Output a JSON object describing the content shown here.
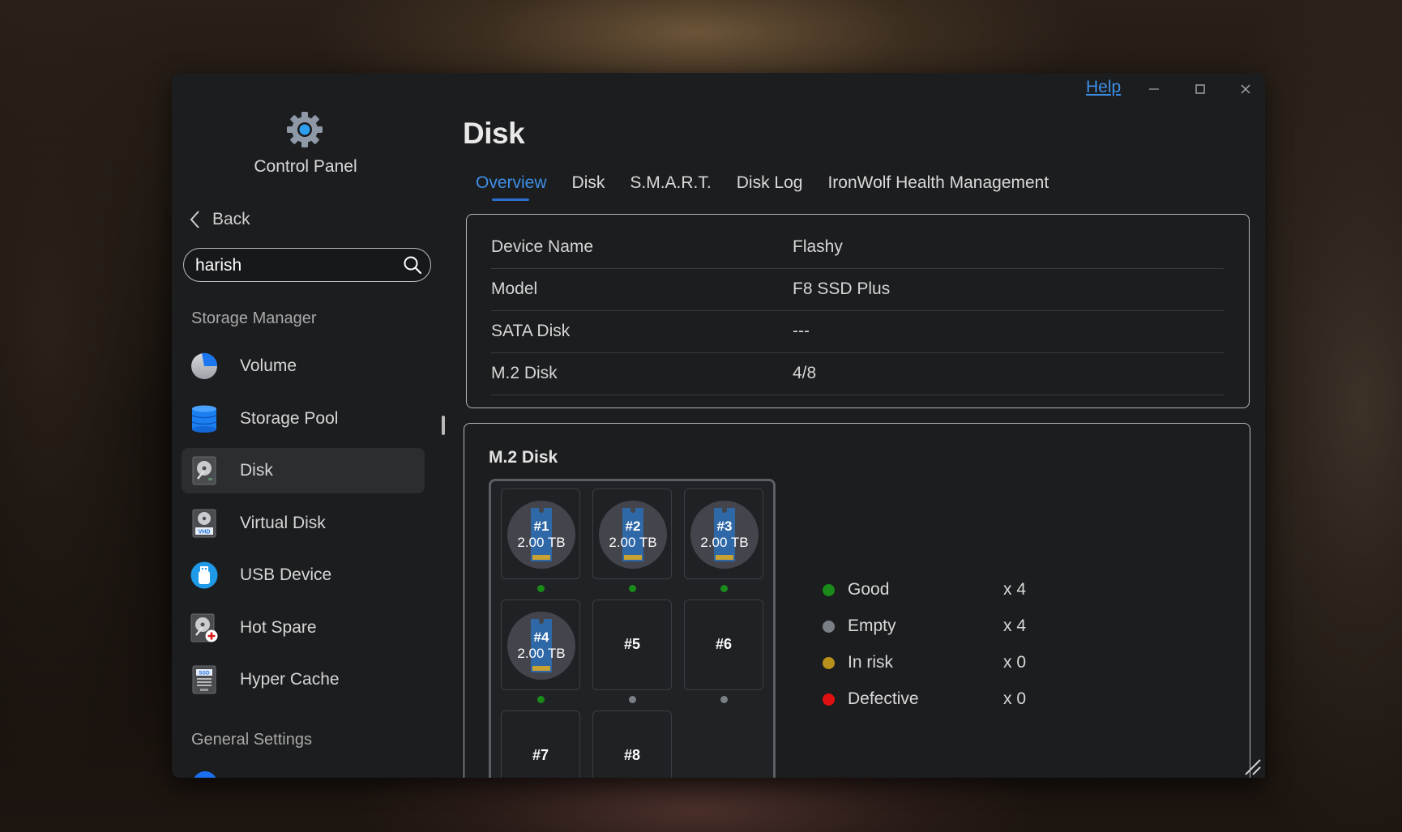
{
  "window": {
    "help_label": "Help",
    "controls": [
      "minimize",
      "maximize",
      "close"
    ]
  },
  "sidebar": {
    "app_title": "Control Panel",
    "app_icon": "gear-icon",
    "back_label": "Back",
    "search": {
      "value": "harish",
      "placeholder": ""
    },
    "sections": [
      {
        "title": "Storage Manager",
        "items": [
          {
            "label": "Volume",
            "icon": "pie-chart-icon",
            "active": false
          },
          {
            "label": "Storage Pool",
            "icon": "database-icon",
            "active": false
          },
          {
            "label": "Disk",
            "icon": "hard-disk-icon",
            "active": true
          },
          {
            "label": "Virtual Disk",
            "icon": "vhd-disk-icon",
            "active": false
          },
          {
            "label": "USB Device",
            "icon": "usb-icon",
            "active": false
          },
          {
            "label": "Hot Spare",
            "icon": "hot-spare-disk-icon",
            "active": false
          },
          {
            "label": "Hyper Cache",
            "icon": "ssd-cache-icon",
            "active": false
          }
        ]
      },
      {
        "title": "General Settings",
        "items": []
      }
    ]
  },
  "main": {
    "title": "Disk",
    "tabs": [
      {
        "label": "Overview",
        "active": true
      },
      {
        "label": "Disk",
        "active": false
      },
      {
        "label": "S.M.A.R.T.",
        "active": false
      },
      {
        "label": "Disk Log",
        "active": false
      },
      {
        "label": "IronWolf Health Management",
        "active": false
      }
    ],
    "info": [
      {
        "label": "Device Name",
        "value": "Flashy"
      },
      {
        "label": "Model",
        "value": "F8 SSD Plus"
      },
      {
        "label": "SATA Disk",
        "value": "---"
      },
      {
        "label": "M.2 Disk",
        "value": "4/8"
      }
    ],
    "m2": {
      "title": "M.2 Disk",
      "bays": [
        {
          "num": "#1",
          "size": "2.00 TB",
          "status": "good"
        },
        {
          "num": "#2",
          "size": "2.00 TB",
          "status": "good"
        },
        {
          "num": "#3",
          "size": "2.00 TB",
          "status": "good"
        },
        {
          "num": "#4",
          "size": "2.00 TB",
          "status": "good"
        },
        {
          "num": "#5",
          "size": null,
          "status": "empty"
        },
        {
          "num": "#6",
          "size": null,
          "status": "empty"
        },
        {
          "num": "#7",
          "size": null,
          "status": "empty"
        },
        {
          "num": "#8",
          "size": null,
          "status": "empty"
        }
      ],
      "legend": [
        {
          "label": "Good",
          "count": "x 4",
          "color": "#1a8a1a"
        },
        {
          "label": "Empty",
          "count": "x 4",
          "color": "#7a7f86"
        },
        {
          "label": "In risk",
          "count": "x 0",
          "color": "#b8901c"
        },
        {
          "label": "Defective",
          "count": "x 0",
          "color": "#e01010"
        }
      ]
    }
  },
  "colors": {
    "accent": "#3d8fe6",
    "good": "#1a8a1a",
    "empty": "#7a7f86",
    "in_risk": "#b8901c",
    "defective": "#e01010"
  }
}
